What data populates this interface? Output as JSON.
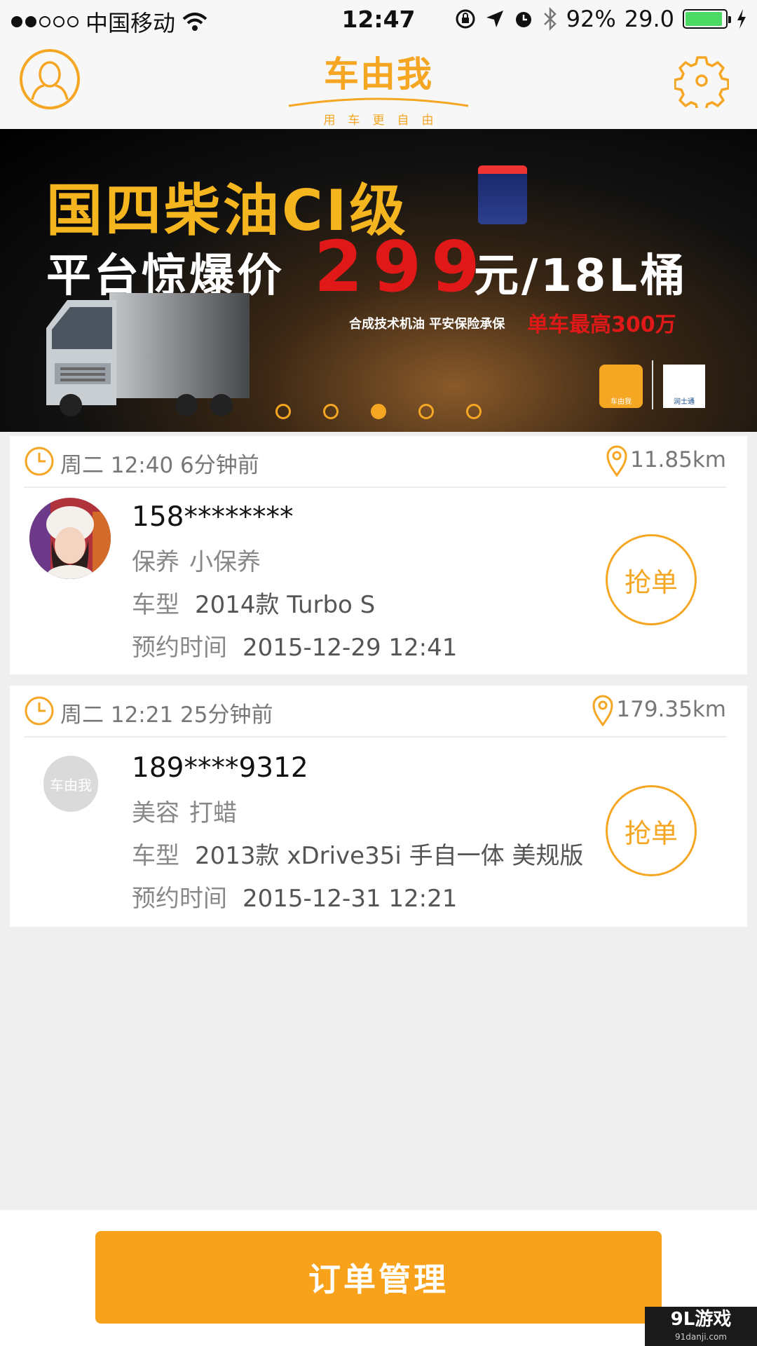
{
  "status_bar": {
    "carrier": "中国移动",
    "time": "12:47",
    "battery_percent": "92%",
    "extra_value": "29.0",
    "battery_level": 0.92
  },
  "header": {
    "logo_title": "车由我",
    "logo_slogan": "用车更自由",
    "left_icon": "user-icon",
    "right_icon": "gear-icon"
  },
  "banner": {
    "headline": "国四柴油CI级",
    "price_prefix": "平台惊爆价",
    "price": "299",
    "price_suffix": "元/18L桶",
    "subline": "合成技术机油 平安保险承保",
    "highlight": "单车最高300万",
    "badge_left": "车由我",
    "badge_right": "润士通",
    "pages": 5,
    "active_page": 3
  },
  "orders": [
    {
      "time_label": "周二 12:40 6分钟前",
      "distance": "11.85km",
      "phone": "158********",
      "service_category": "保养",
      "service_item": "小保养",
      "car_label": "车型",
      "car_model": "2014款 Turbo S",
      "appointment_label": "预约时间",
      "appointment_time": "2015-12-29 12:41",
      "grab_label": "抢单",
      "avatar_text": ""
    },
    {
      "time_label": "周二 12:21 25分钟前",
      "distance": "179.35km",
      "phone": "189****9312",
      "service_category": "美容",
      "service_item": "打蜡",
      "car_label": "车型",
      "car_model": "2013款 xDrive35i 手自一体 美规版",
      "appointment_label": "预约时间",
      "appointment_time": "2015-12-31 12:21",
      "grab_label": "抢单",
      "avatar_text": "车由我"
    }
  ],
  "bottom": {
    "order_management_label": "订单管理"
  },
  "watermark": {
    "main": "9L游戏",
    "sub": "91danji.com"
  },
  "colors": {
    "accent": "#f5a623",
    "button": "#f8a11b",
    "price_red": "#e01818"
  }
}
